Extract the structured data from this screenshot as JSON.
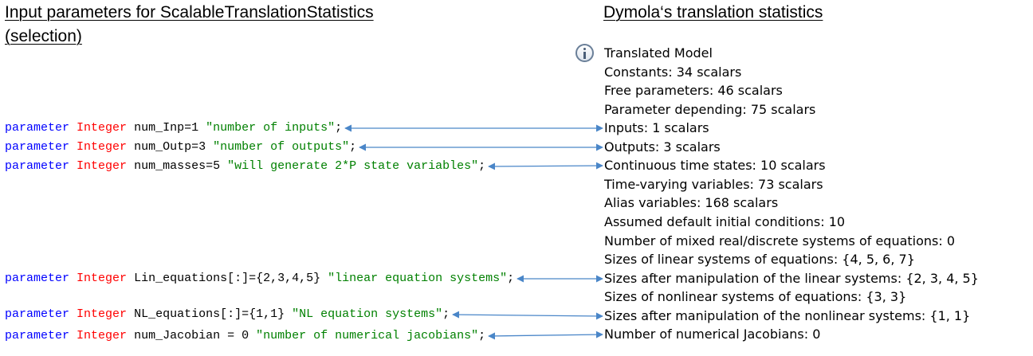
{
  "headings": {
    "left_line1": "Input parameters for ScalableTranslationStatistics",
    "left_line2": "(selection)",
    "right": "Dymola‘s translation statistics"
  },
  "icons": {
    "info": "info-icon"
  },
  "code_lines": [
    {
      "kw": "parameter",
      "type": "Integer",
      "decl": "num_Inp=1 ",
      "str": "\"number of inputs\"",
      "end": ";"
    },
    {
      "kw": "parameter",
      "type": "Integer",
      "decl": "num_Outp=3 ",
      "str": "\"number of outputs\"",
      "end": ";"
    },
    {
      "kw": "parameter",
      "type": "Integer",
      "decl": "num_masses=5 ",
      "str": "\"will generate 2*P state variables\"",
      "end": ";"
    },
    {
      "kw": "parameter",
      "type": "Integer",
      "decl": "Lin_equations[:]={2,3,4,5} ",
      "str": "\"linear equation systems\"",
      "end": ";"
    },
    {
      "kw": "parameter",
      "type": "Integer",
      "decl": "NL_equations[:]={1,1} ",
      "str": "\"NL equation systems\"",
      "end": ";"
    },
    {
      "kw": "parameter",
      "type": "Integer",
      "decl": "num_Jacobian = 0 ",
      "str": "\"number of numerical jacobians\"",
      "end": ";"
    }
  ],
  "stats": [
    "Translated Model",
    "Constants: 34 scalars",
    "Free parameters: 46 scalars",
    "Parameter depending: 75 scalars",
    "Inputs: 1 scalars",
    "Outputs: 3 scalars",
    "Continuous time states: 10 scalars",
    "Time-varying variables: 73 scalars",
    "Alias variables: 168 scalars",
    "Assumed default initial conditions: 10",
    "Number of mixed real/discrete systems of equations: 0",
    "Sizes of linear systems of equations: {4, 5, 6, 7}",
    "Sizes after manipulation of the linear systems: {2, 3, 4, 5}",
    "Sizes of nonlinear systems of equations: {3, 3}",
    "Sizes after manipulation of the nonlinear systems: {1, 1}",
    "Number of numerical Jacobians: 0"
  ],
  "connections": [
    {
      "code": 0,
      "stat": 4
    },
    {
      "code": 1,
      "stat": 5
    },
    {
      "code": 2,
      "stat": 6
    },
    {
      "code": 3,
      "stat": 12
    },
    {
      "code": 4,
      "stat": 14
    },
    {
      "code": 5,
      "stat": 15
    }
  ],
  "colors": {
    "keyword": "#0000ff",
    "type": "#ff0000",
    "string": "#008000",
    "arrow": "#4a86c8"
  }
}
